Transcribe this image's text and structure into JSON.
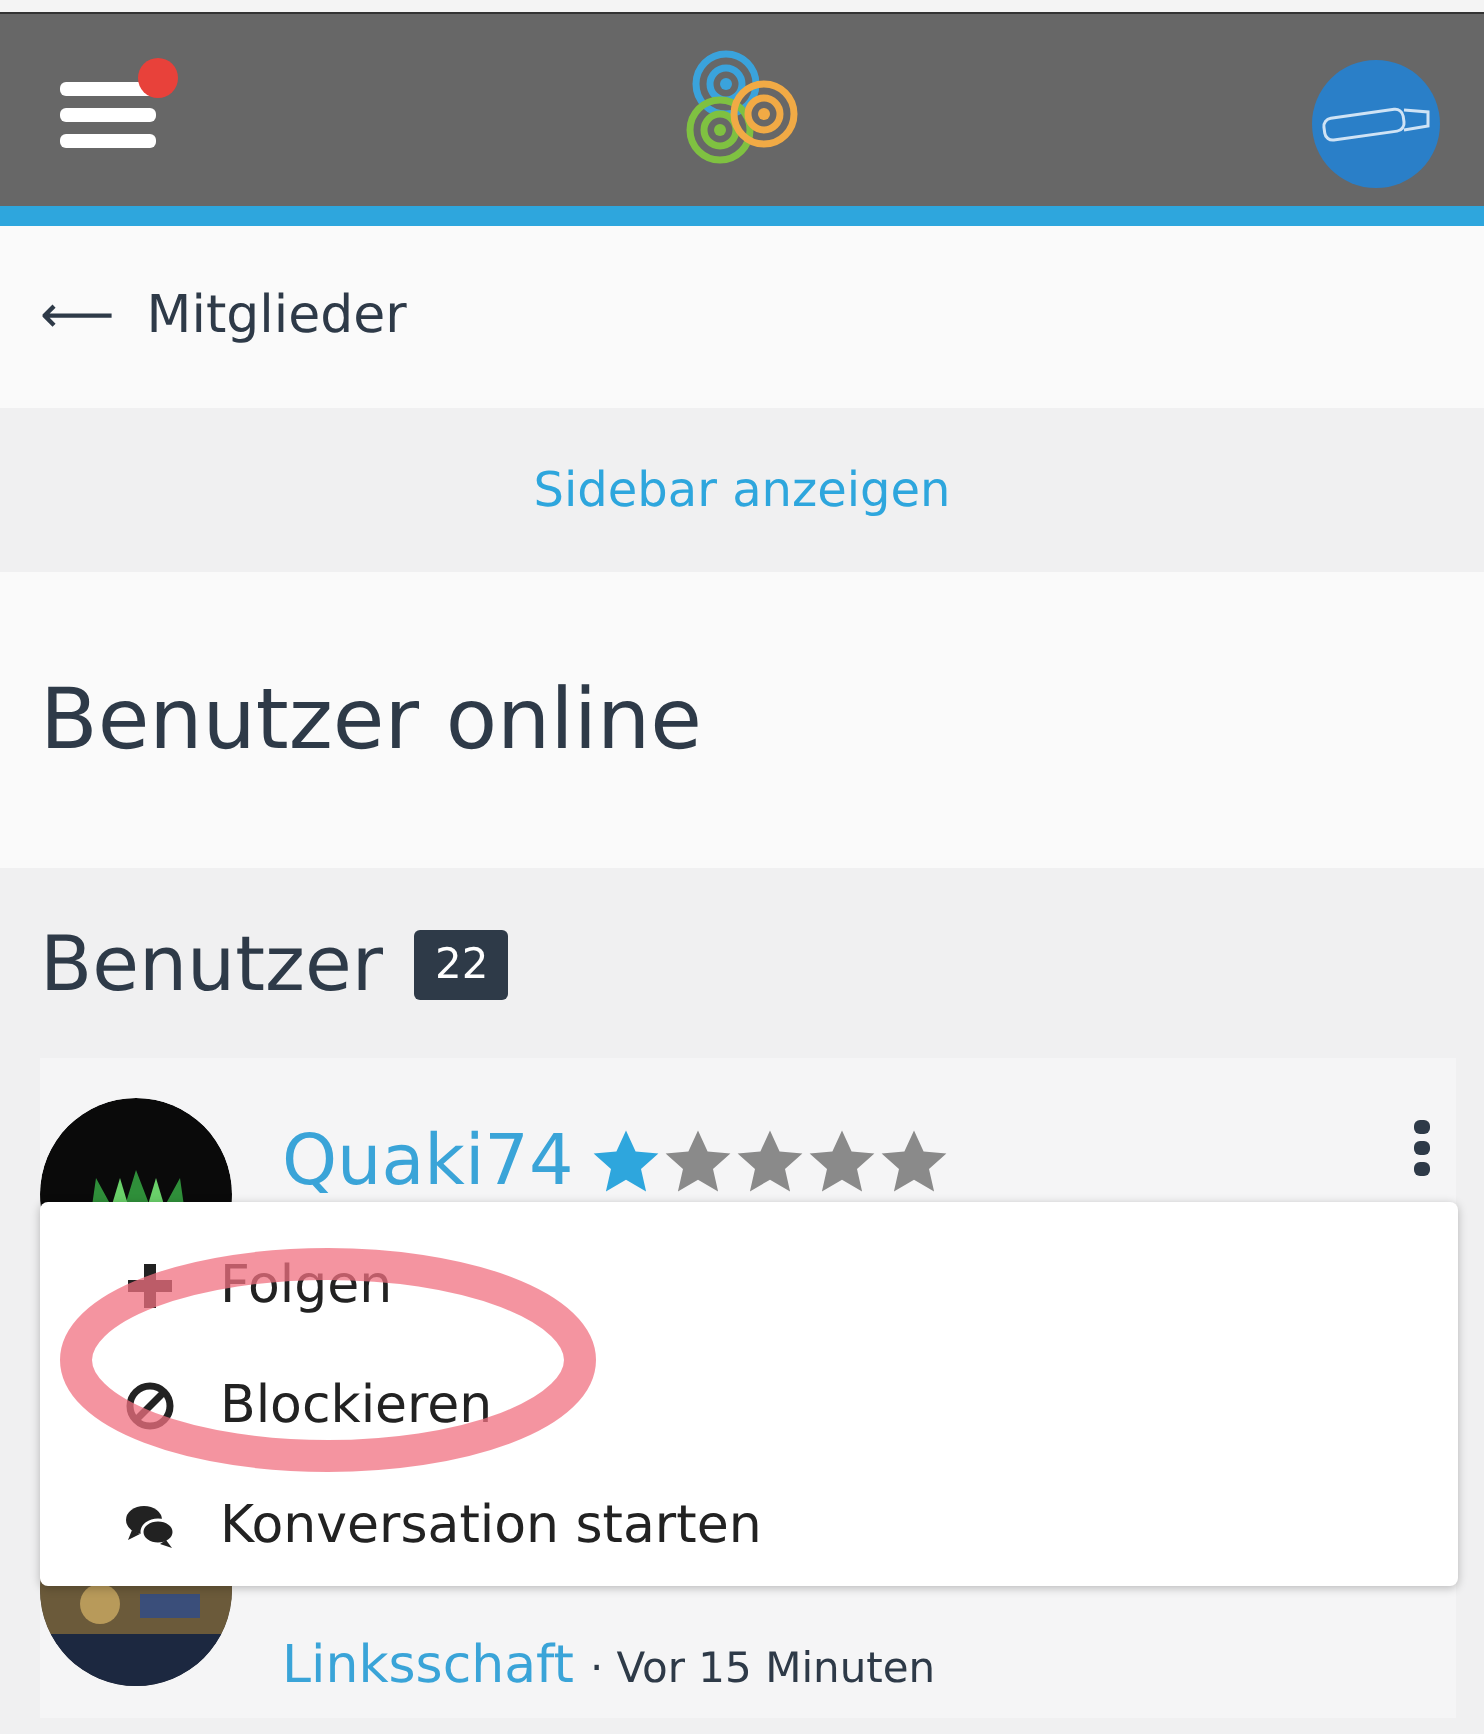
{
  "header": {
    "unread_notification": true
  },
  "breadcrumb": {
    "label": "Mitglieder",
    "arrow": "⟵"
  },
  "sidebar_toggle": "Sidebar anzeigen",
  "page_title": "Benutzer online",
  "section": {
    "title": "Benutzer",
    "count": "22"
  },
  "users": [
    {
      "name": "Quaki74",
      "stars": 1,
      "menu_open": true
    },
    {
      "link": "Linksschaft",
      "time": "· Vor 15 Minuten"
    }
  ],
  "menu": [
    {
      "label": "Folgen",
      "kind": "follow"
    },
    {
      "label": "Blockieren",
      "kind": "block",
      "circled": true
    },
    {
      "label": "Konversation starten",
      "kind": "conversation"
    }
  ]
}
